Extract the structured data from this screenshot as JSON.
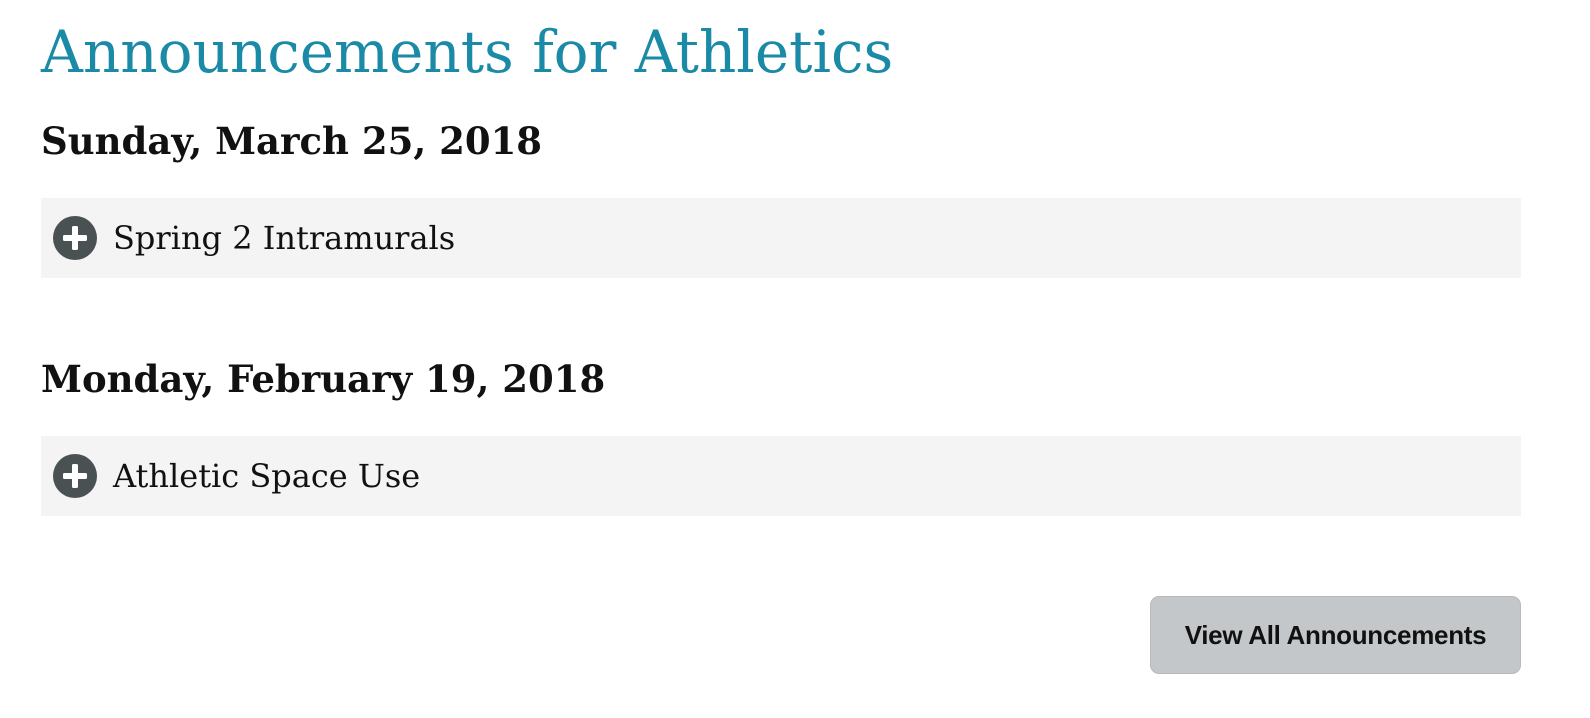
{
  "page": {
    "title": "Announcements for Athletics"
  },
  "groups": [
    {
      "date": "Sunday, March 25, 2018",
      "items": [
        {
          "title": "Spring 2 Intramurals",
          "icon": "plus-circle-icon"
        }
      ]
    },
    {
      "date": "Monday, February 19, 2018",
      "items": [
        {
          "title": "Athletic Space Use",
          "icon": "plus-circle-icon"
        }
      ]
    }
  ],
  "actions": {
    "view_all_label": "View All Announcements"
  },
  "colors": {
    "title": "#1a8aa6",
    "item_background": "#f4f4f4",
    "icon": "#4a5152",
    "button_background": "#c4c7c9"
  }
}
